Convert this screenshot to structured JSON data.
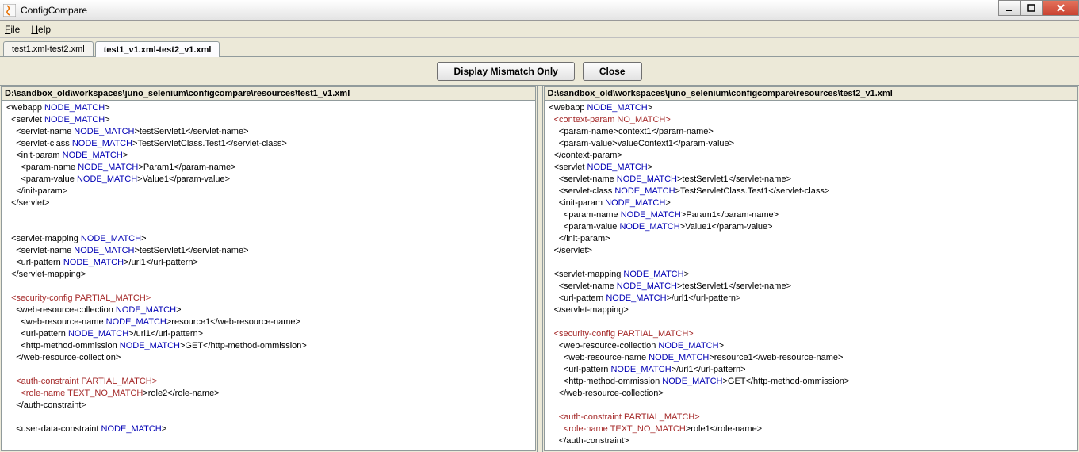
{
  "window": {
    "title": "ConfigCompare"
  },
  "menu": {
    "file": "File",
    "help": "Help"
  },
  "tabs": [
    {
      "label": "test1.xml-test2.xml"
    },
    {
      "label": "test1_v1.xml-test2_v1.xml"
    }
  ],
  "toolbar": {
    "mismatch": "Display Mismatch Only",
    "close": "Close"
  },
  "left": {
    "path": "D:\\sandbox_old\\workspaces\\juno_selenium\\configcompare\\resources\\test1_v1.xml",
    "lines": [
      {
        "indent": 0,
        "parts": [
          {
            "t": "<webapp ",
            "c": "blk"
          },
          {
            "t": "NODE_MATCH",
            "c": "nm"
          },
          {
            "t": ">",
            "c": "blk"
          }
        ]
      },
      {
        "indent": 1,
        "parts": [
          {
            "t": "<servlet ",
            "c": "blk"
          },
          {
            "t": "NODE_MATCH",
            "c": "nm"
          },
          {
            "t": ">",
            "c": "blk"
          }
        ]
      },
      {
        "indent": 2,
        "parts": [
          {
            "t": "<servlet-name ",
            "c": "blk"
          },
          {
            "t": "NODE_MATCH",
            "c": "nm"
          },
          {
            "t": ">testServlet1</servlet-name>",
            "c": "blk"
          }
        ]
      },
      {
        "indent": 2,
        "parts": [
          {
            "t": "<servlet-class ",
            "c": "blk"
          },
          {
            "t": "NODE_MATCH",
            "c": "nm"
          },
          {
            "t": ">TestServletClass.Test1</servlet-class>",
            "c": "blk"
          }
        ]
      },
      {
        "indent": 2,
        "parts": [
          {
            "t": "<init-param ",
            "c": "blk"
          },
          {
            "t": "NODE_MATCH",
            "c": "nm"
          },
          {
            "t": ">",
            "c": "blk"
          }
        ]
      },
      {
        "indent": 3,
        "parts": [
          {
            "t": "<param-name ",
            "c": "blk"
          },
          {
            "t": "NODE_MATCH",
            "c": "nm"
          },
          {
            "t": ">Param1</param-name>",
            "c": "blk"
          }
        ]
      },
      {
        "indent": 3,
        "parts": [
          {
            "t": "<param-value ",
            "c": "blk"
          },
          {
            "t": "NODE_MATCH",
            "c": "nm"
          },
          {
            "t": ">Value1</param-value>",
            "c": "blk"
          }
        ]
      },
      {
        "indent": 2,
        "parts": [
          {
            "t": "</init-param>",
            "c": "blk"
          }
        ]
      },
      {
        "indent": 1,
        "parts": [
          {
            "t": "</servlet>",
            "c": "blk"
          }
        ]
      },
      {
        "indent": 0,
        "parts": [
          {
            "t": "",
            "c": "blk"
          }
        ]
      },
      {
        "indent": 0,
        "parts": [
          {
            "t": "",
            "c": "blk"
          }
        ]
      },
      {
        "indent": 1,
        "parts": [
          {
            "t": "<servlet-mapping ",
            "c": "blk"
          },
          {
            "t": "NODE_MATCH",
            "c": "nm"
          },
          {
            "t": ">",
            "c": "blk"
          }
        ]
      },
      {
        "indent": 2,
        "parts": [
          {
            "t": "<servlet-name ",
            "c": "blk"
          },
          {
            "t": "NODE_MATCH",
            "c": "nm"
          },
          {
            "t": ">testServlet1</servlet-name>",
            "c": "blk"
          }
        ]
      },
      {
        "indent": 2,
        "parts": [
          {
            "t": "<url-pattern ",
            "c": "blk"
          },
          {
            "t": "NODE_MATCH",
            "c": "nm"
          },
          {
            "t": ">/url1</url-pattern>",
            "c": "blk"
          }
        ]
      },
      {
        "indent": 1,
        "parts": [
          {
            "t": "</servlet-mapping>",
            "c": "blk"
          }
        ]
      },
      {
        "indent": 0,
        "parts": [
          {
            "t": "",
            "c": "blk"
          }
        ]
      },
      {
        "indent": 1,
        "parts": [
          {
            "t": "<security-config ",
            "c": "pm"
          },
          {
            "t": "PARTIAL_MATCH",
            "c": "pm"
          },
          {
            "t": ">",
            "c": "pm"
          }
        ]
      },
      {
        "indent": 2,
        "parts": [
          {
            "t": "<web-resource-collection ",
            "c": "blk"
          },
          {
            "t": "NODE_MATCH",
            "c": "nm"
          },
          {
            "t": ">",
            "c": "blk"
          }
        ]
      },
      {
        "indent": 3,
        "parts": [
          {
            "t": "<web-resource-name ",
            "c": "blk"
          },
          {
            "t": "NODE_MATCH",
            "c": "nm"
          },
          {
            "t": ">resource1</web-resource-name>",
            "c": "blk"
          }
        ]
      },
      {
        "indent": 3,
        "parts": [
          {
            "t": "<url-pattern ",
            "c": "blk"
          },
          {
            "t": "NODE_MATCH",
            "c": "nm"
          },
          {
            "t": ">/url1</url-pattern>",
            "c": "blk"
          }
        ]
      },
      {
        "indent": 3,
        "parts": [
          {
            "t": "<http-method-ommission ",
            "c": "blk"
          },
          {
            "t": "NODE_MATCH",
            "c": "nm"
          },
          {
            "t": ">GET</http-method-ommission>",
            "c": "blk"
          }
        ]
      },
      {
        "indent": 2,
        "parts": [
          {
            "t": "</web-resource-collection>",
            "c": "blk"
          }
        ]
      },
      {
        "indent": 0,
        "parts": [
          {
            "t": "",
            "c": "blk"
          }
        ]
      },
      {
        "indent": 2,
        "parts": [
          {
            "t": "<auth-constraint ",
            "c": "pm"
          },
          {
            "t": "PARTIAL_MATCH",
            "c": "pm"
          },
          {
            "t": ">",
            "c": "pm"
          }
        ]
      },
      {
        "indent": 3,
        "parts": [
          {
            "t": "<role-name ",
            "c": "nomatch"
          },
          {
            "t": "TEXT_NO_MATCH",
            "c": "nomatch"
          },
          {
            "t": ">role2</role-name>",
            "c": "blk"
          }
        ]
      },
      {
        "indent": 2,
        "parts": [
          {
            "t": "</auth-constraint>",
            "c": "blk"
          }
        ]
      },
      {
        "indent": 0,
        "parts": [
          {
            "t": "",
            "c": "blk"
          }
        ]
      },
      {
        "indent": 2,
        "parts": [
          {
            "t": "<user-data-constraint ",
            "c": "blk"
          },
          {
            "t": "NODE_MATCH",
            "c": "nm"
          },
          {
            "t": ">",
            "c": "blk"
          }
        ]
      }
    ]
  },
  "right": {
    "path": "D:\\sandbox_old\\workspaces\\juno_selenium\\configcompare\\resources\\test2_v1.xml",
    "lines": [
      {
        "indent": 0,
        "parts": [
          {
            "t": "<webapp ",
            "c": "blk"
          },
          {
            "t": "NODE_MATCH",
            "c": "nm"
          },
          {
            "t": ">",
            "c": "blk"
          }
        ]
      },
      {
        "indent": 1,
        "parts": [
          {
            "t": "<context-param ",
            "c": "nomatch"
          },
          {
            "t": "NO_MATCH",
            "c": "nomatch"
          },
          {
            "t": ">",
            "c": "nomatch"
          }
        ]
      },
      {
        "indent": 2,
        "parts": [
          {
            "t": "<param-name>context1</param-name>",
            "c": "blk"
          }
        ]
      },
      {
        "indent": 2,
        "parts": [
          {
            "t": "<param-value>valueContext1</param-value>",
            "c": "blk"
          }
        ]
      },
      {
        "indent": 1,
        "parts": [
          {
            "t": "</context-param>",
            "c": "blk"
          }
        ]
      },
      {
        "indent": 1,
        "parts": [
          {
            "t": "<servlet ",
            "c": "blk"
          },
          {
            "t": "NODE_MATCH",
            "c": "nm"
          },
          {
            "t": ">",
            "c": "blk"
          }
        ]
      },
      {
        "indent": 2,
        "parts": [
          {
            "t": "<servlet-name ",
            "c": "blk"
          },
          {
            "t": "NODE_MATCH",
            "c": "nm"
          },
          {
            "t": ">testServlet1</servlet-name>",
            "c": "blk"
          }
        ]
      },
      {
        "indent": 2,
        "parts": [
          {
            "t": "<servlet-class ",
            "c": "blk"
          },
          {
            "t": "NODE_MATCH",
            "c": "nm"
          },
          {
            "t": ">TestServletClass.Test1</servlet-class>",
            "c": "blk"
          }
        ]
      },
      {
        "indent": 2,
        "parts": [
          {
            "t": "<init-param ",
            "c": "blk"
          },
          {
            "t": "NODE_MATCH",
            "c": "nm"
          },
          {
            "t": ">",
            "c": "blk"
          }
        ]
      },
      {
        "indent": 3,
        "parts": [
          {
            "t": "<param-name ",
            "c": "blk"
          },
          {
            "t": "NODE_MATCH",
            "c": "nm"
          },
          {
            "t": ">Param1</param-name>",
            "c": "blk"
          }
        ]
      },
      {
        "indent": 3,
        "parts": [
          {
            "t": "<param-value ",
            "c": "blk"
          },
          {
            "t": "NODE_MATCH",
            "c": "nm"
          },
          {
            "t": ">Value1</param-value>",
            "c": "blk"
          }
        ]
      },
      {
        "indent": 2,
        "parts": [
          {
            "t": "</init-param>",
            "c": "blk"
          }
        ]
      },
      {
        "indent": 1,
        "parts": [
          {
            "t": "</servlet>",
            "c": "blk"
          }
        ]
      },
      {
        "indent": 0,
        "parts": [
          {
            "t": "",
            "c": "blk"
          }
        ]
      },
      {
        "indent": 1,
        "parts": [
          {
            "t": "<servlet-mapping ",
            "c": "blk"
          },
          {
            "t": "NODE_MATCH",
            "c": "nm"
          },
          {
            "t": ">",
            "c": "blk"
          }
        ]
      },
      {
        "indent": 2,
        "parts": [
          {
            "t": "<servlet-name ",
            "c": "blk"
          },
          {
            "t": "NODE_MATCH",
            "c": "nm"
          },
          {
            "t": ">testServlet1</servlet-name>",
            "c": "blk"
          }
        ]
      },
      {
        "indent": 2,
        "parts": [
          {
            "t": "<url-pattern ",
            "c": "blk"
          },
          {
            "t": "NODE_MATCH",
            "c": "nm"
          },
          {
            "t": ">/url1</url-pattern>",
            "c": "blk"
          }
        ]
      },
      {
        "indent": 1,
        "parts": [
          {
            "t": "</servlet-mapping>",
            "c": "blk"
          }
        ]
      },
      {
        "indent": 0,
        "parts": [
          {
            "t": "",
            "c": "blk"
          }
        ]
      },
      {
        "indent": 1,
        "parts": [
          {
            "t": "<security-config ",
            "c": "pm"
          },
          {
            "t": "PARTIAL_MATCH",
            "c": "pm"
          },
          {
            "t": ">",
            "c": "pm"
          }
        ]
      },
      {
        "indent": 2,
        "parts": [
          {
            "t": "<web-resource-collection ",
            "c": "blk"
          },
          {
            "t": "NODE_MATCH",
            "c": "nm"
          },
          {
            "t": ">",
            "c": "blk"
          }
        ]
      },
      {
        "indent": 3,
        "parts": [
          {
            "t": "<web-resource-name ",
            "c": "blk"
          },
          {
            "t": "NODE_MATCH",
            "c": "nm"
          },
          {
            "t": ">resource1</web-resource-name>",
            "c": "blk"
          }
        ]
      },
      {
        "indent": 3,
        "parts": [
          {
            "t": "<url-pattern ",
            "c": "blk"
          },
          {
            "t": "NODE_MATCH",
            "c": "nm"
          },
          {
            "t": ">/url1</url-pattern>",
            "c": "blk"
          }
        ]
      },
      {
        "indent": 3,
        "parts": [
          {
            "t": "<http-method-ommission ",
            "c": "blk"
          },
          {
            "t": "NODE_MATCH",
            "c": "nm"
          },
          {
            "t": ">GET</http-method-ommission>",
            "c": "blk"
          }
        ]
      },
      {
        "indent": 2,
        "parts": [
          {
            "t": "</web-resource-collection>",
            "c": "blk"
          }
        ]
      },
      {
        "indent": 0,
        "parts": [
          {
            "t": "",
            "c": "blk"
          }
        ]
      },
      {
        "indent": 2,
        "parts": [
          {
            "t": "<auth-constraint ",
            "c": "pm"
          },
          {
            "t": "PARTIAL_MATCH",
            "c": "pm"
          },
          {
            "t": ">",
            "c": "pm"
          }
        ]
      },
      {
        "indent": 3,
        "parts": [
          {
            "t": "<role-name ",
            "c": "nomatch"
          },
          {
            "t": "TEXT_NO_MATCH",
            "c": "nomatch"
          },
          {
            "t": ">role1</role-name>",
            "c": "blk"
          }
        ]
      },
      {
        "indent": 2,
        "parts": [
          {
            "t": "</auth-constraint>",
            "c": "blk"
          }
        ]
      }
    ]
  }
}
